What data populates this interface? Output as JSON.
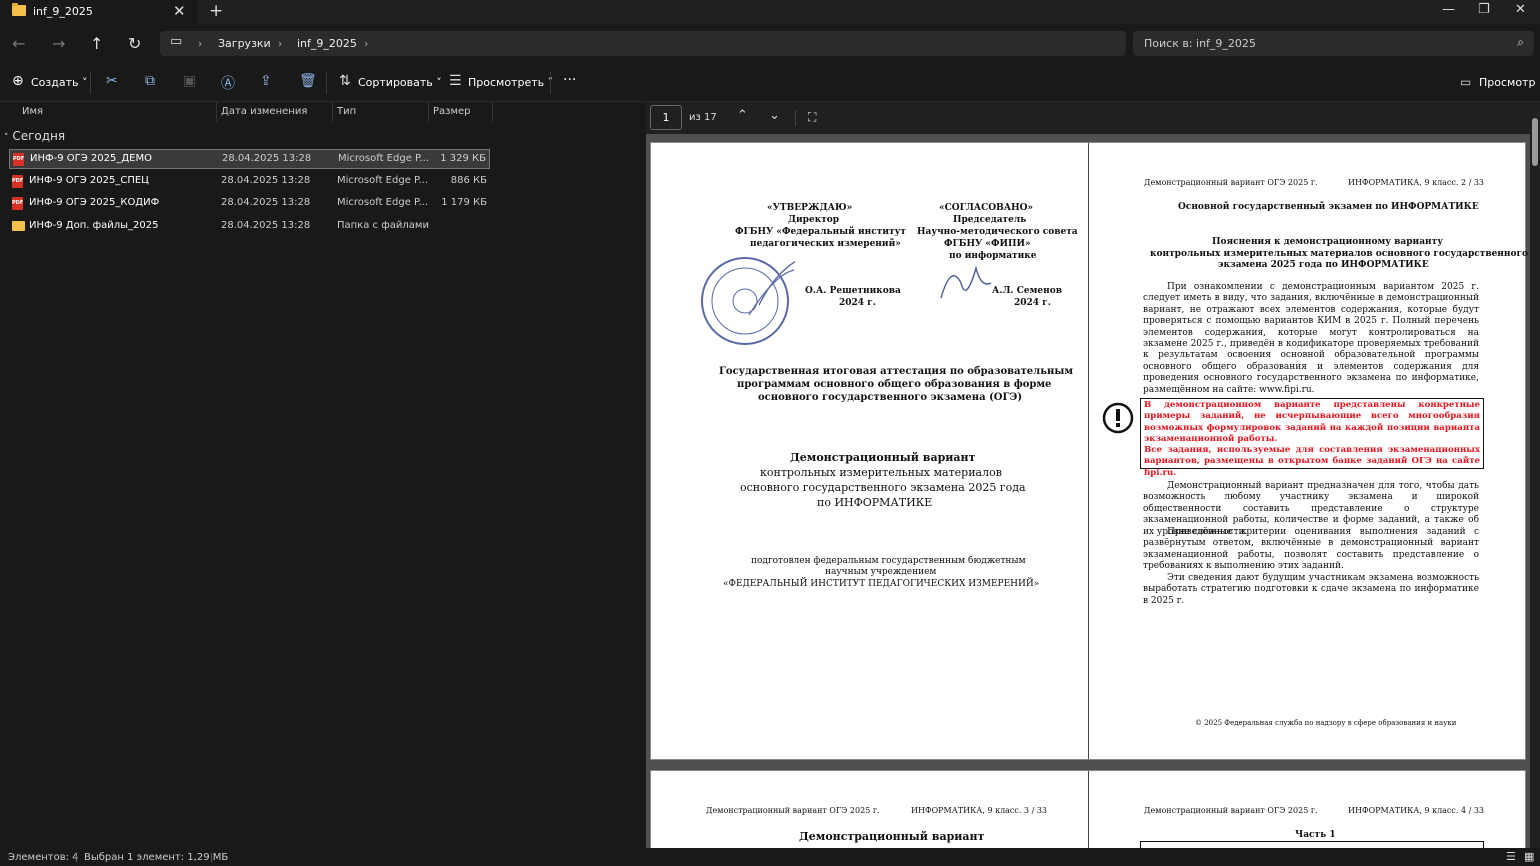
{
  "window": {
    "tab_title": "inf_9_2025",
    "new_tab": "+",
    "minimize": "—",
    "maximize": "❐",
    "close": "✕"
  },
  "nav": {
    "back": "←",
    "forward": "→",
    "up": "↑",
    "refresh": "↻"
  },
  "address": {
    "crumbs": [
      "Загрузки",
      "inf_9_2025"
    ]
  },
  "search": {
    "placeholder": "Поиск в: inf_9_2025"
  },
  "toolbar": {
    "create": "Создать",
    "sort": "Сортировать",
    "view": "Просмотреть",
    "more": "···",
    "preview": "Просмотр"
  },
  "columns": {
    "name": "Имя",
    "date": "Дата изменения",
    "type": "Тип",
    "size": "Размер"
  },
  "group": "Сегодня",
  "files": [
    {
      "name": "ИНФ-9 ОГЭ 2025_ДЕМО",
      "date": "28.04.2025 13:28",
      "type": "Microsoft Edge P...",
      "size": "1 329 КБ",
      "kind": "pdf"
    },
    {
      "name": "ИНФ-9 ОГЭ 2025_СПЕЦ",
      "date": "28.04.2025 13:28",
      "type": "Microsoft Edge P...",
      "size": "886 КБ",
      "kind": "pdf"
    },
    {
      "name": "ИНФ-9 ОГЭ 2025_КОДИФ",
      "date": "28.04.2025 13:28",
      "type": "Microsoft Edge P...",
      "size": "1 179 КБ",
      "kind": "pdf"
    },
    {
      "name": "ИНФ-9 Доп. файлы_2025",
      "date": "28.04.2025 13:28",
      "type": "Папка с файлами",
      "size": "",
      "kind": "folder"
    }
  ],
  "status": {
    "count": "Элементов: 4",
    "selected": "Выбран 1 элемент: 1,29 МБ"
  },
  "viewer": {
    "page": "1",
    "of": "из 17"
  },
  "pdf": {
    "approve": "«УТВЕРЖДАЮ»",
    "dir": "Директор",
    "fgbnu": "ФГБНУ «Федеральный институт",
    "ped": "педагогических измерений»",
    "resh": "О.А. Решетникова",
    "date1": "2024 г.",
    "agreed": "«СОГЛАСОВАНО»",
    "chair": "Председатель",
    "nms": "Научно-методического совета",
    "fipi": "ФГБНУ «ФИПИ»",
    "inf": "по информатике",
    "semenov": "А.Л. Семенов",
    "date2": "2024 г.",
    "gia1": "Государственная итоговая аттестация по образовательным",
    "gia2": "программам основного общего образования в форме",
    "gia3": "основного государственного экзамена (ОГЭ)",
    "demo": "Демонстрационный вариант",
    "kim1": "контрольных измерительных материалов",
    "kim2": "основного государственного экзамена 2025 года",
    "kim3": "по ИНФОРМАТИКЕ",
    "prep1": "подготовлен федеральным государственным бюджетным",
    "prep2": "научным учреждением",
    "prep3": "«ФЕДЕРАЛЬНЫЙ ИНСТИТУТ ПЕДАГОГИЧЕСКИХ ИЗМЕРЕНИЙ»",
    "hdr_l": "Демонстрационный вариант ОГЭ 2025 г.",
    "hdr_r2": "ИНФОРМАТИКА, 9 класс.   2 / 33",
    "main": "Основной государственный экзамен по ИНФОРМАТИКЕ",
    "exp1": "Пояснения к демонстрационному варианту",
    "exp2": "контрольных измерительных материалов основного государственного",
    "exp3": "экзамена 2025 года по ИНФОРМАТИКЕ",
    "p1": "При ознакомлении с демонстрационным вариантом 2025 г. следует иметь в виду, что задания, включённые в демонстрационный вариант, не отражают всех элементов содержания, которые будут проверяться с помощью вариантов КИМ в 2025 г. Полный перечень элементов содержания, которые могут контролироваться на экзамене 2025 г., приведён в кодификаторе проверяемых требований к результатам освоения основной образовательной программы основного общего образования и элементов содержания для проведения основного государственного экзамена по информатике, размещённом на сайте: www.fipi.ru.",
    "warn1": "В демонстрационном варианте представлены конкретные примеры заданий, не исчерпывающие всего многообразия возможных формулировок заданий на каждой позиции варианта экзаменационной работы.",
    "warn2": "Все задания, используемые для составления экзаменационных вариантов, размещены в открытом банке заданий ОГЭ на сайте fipi.ru.",
    "p2": "Демонстрационный вариант предназначен для того, чтобы дать возможность любому участнику экзамена и широкой общественности составить представление о структуре экзаменационной работы, количестве и форме заданий, а также об их уровне сложности.",
    "p3": "Приведённые критерии оценивания выполнения заданий с развёрнутым ответом, включённые в демонстрационный вариант экзаменационной работы, позволят составить представление о требованиях к выполнению этих заданий.",
    "p4": "Эти сведения дают будущим участникам экзамена возможность выработать стратегию подготовки к сдаче экзамена по информатике в 2025 г.",
    "copy": "© 2025 Федеральная служба по надзору в сфере образования и науки",
    "hdr_r3": "ИНФОРМАТИКА, 9 класс.   3 / 33",
    "hdr_r4": "ИНФОРМАТИКА, 9 класс.   4 / 33",
    "demo3": "Демонстрационный вариант",
    "part1": "Часть 1"
  }
}
